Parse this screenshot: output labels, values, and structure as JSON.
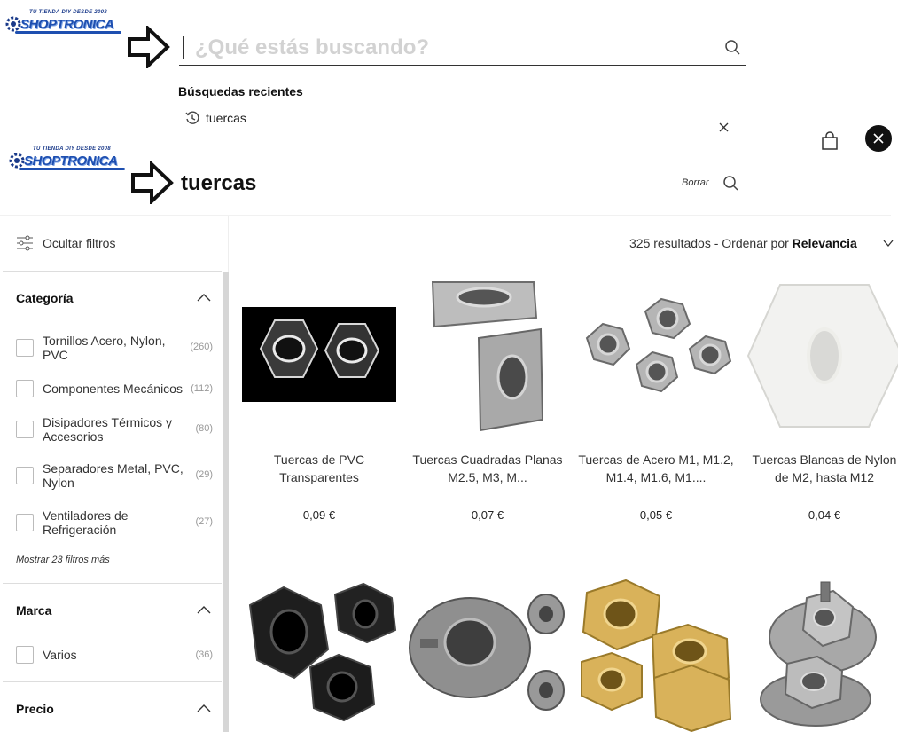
{
  "store": {
    "name": "SHOPTRONICA",
    "tagline": "TU TIENDA DIY DESDE 2008"
  },
  "search_overlay": {
    "placeholder": "¿Qué estás buscando?",
    "recent_heading": "Búsquedas recientes",
    "recent_items": [
      "tuercas"
    ]
  },
  "search_bar": {
    "query": "tuercas",
    "clear_label": "Borrar"
  },
  "toolbar": {
    "hide_filters_label": "Ocultar filtros"
  },
  "results": {
    "count": "325 resultados",
    "sort_prefix": "- Ordenar por",
    "sort_value": "Relevancia"
  },
  "filters": {
    "category": {
      "title": "Categoría",
      "items": [
        {
          "label": "Tornillos Acero, Nylon, PVC",
          "count": "(260)"
        },
        {
          "label": "Componentes Mecánicos",
          "count": "(112)"
        },
        {
          "label": "Disipadores Térmicos y Accesorios",
          "count": "(80)"
        },
        {
          "label": "Separadores Metal, PVC, Nylon",
          "count": "(29)"
        },
        {
          "label": "Ventiladores de Refrigeración",
          "count": "(27)"
        }
      ],
      "more_label": "Mostrar 23 filtros más"
    },
    "brand": {
      "title": "Marca",
      "items": [
        {
          "label": "Varios",
          "count": "(36)"
        }
      ]
    },
    "price": {
      "title": "Precio"
    }
  },
  "products": [
    {
      "title": "Tuercas de PVC Transparentes",
      "price": "0,09 €"
    },
    {
      "title": "Tuercas Cuadradas Planas M2.5, M3, M...",
      "price": "0,07 €"
    },
    {
      "title": "Tuercas de Acero M1, M1.2, M1.4, M1.6, M1....",
      "price": "0,05 €"
    },
    {
      "title": "Tuercas Blancas de Nylon de M2, hasta M12",
      "price": "0,04 €"
    }
  ],
  "colors": {
    "brand_blue": "#1e4fb0",
    "placeholder_gray": "#d2d2d2"
  },
  "icons": [
    "arrow-right-icon",
    "search-icon",
    "history-icon",
    "close-icon",
    "bag-icon",
    "close-circle-icon",
    "filter-sliders-icon",
    "chevron-up-icon",
    "chevron-down-icon"
  ]
}
